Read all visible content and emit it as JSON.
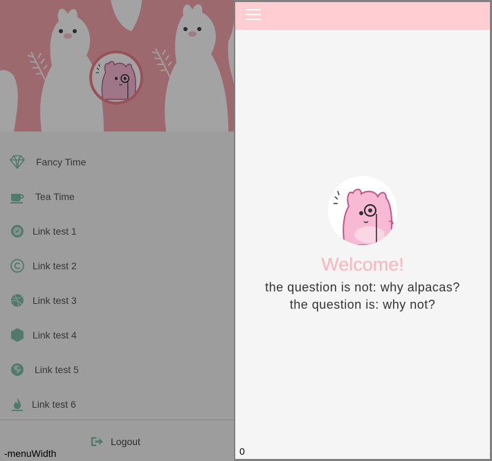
{
  "sidemenu": {
    "items": [
      {
        "label": "Fancy Time",
        "icon": "diamond-icon"
      },
      {
        "label": "Tea Time",
        "icon": "coffee-cup-icon"
      },
      {
        "label": "Link test 1",
        "icon": "compass-icon"
      },
      {
        "label": "Link test 2",
        "icon": "copyright-icon"
      },
      {
        "label": "Link test 3",
        "icon": "dribbble-icon"
      },
      {
        "label": "Link test 4",
        "icon": "hexagon-icon"
      },
      {
        "label": "Link test 5",
        "icon": "firefox-icon"
      },
      {
        "label": "Link test 6",
        "icon": "fire-icon"
      }
    ],
    "logout_label": "Logout",
    "menuwidth_label": "-menuWidth"
  },
  "main": {
    "welcome": "Welcome!",
    "tagline_line1": "the question is not: why alpacas?",
    "tagline_line2": "the question is: why not?",
    "counter": "0"
  },
  "colors": {
    "topbar": "#ffcdd2",
    "welcome": "#ffb3ba",
    "header_pink": "#f5a6ad",
    "menu_icon": "#7fbfa5"
  }
}
